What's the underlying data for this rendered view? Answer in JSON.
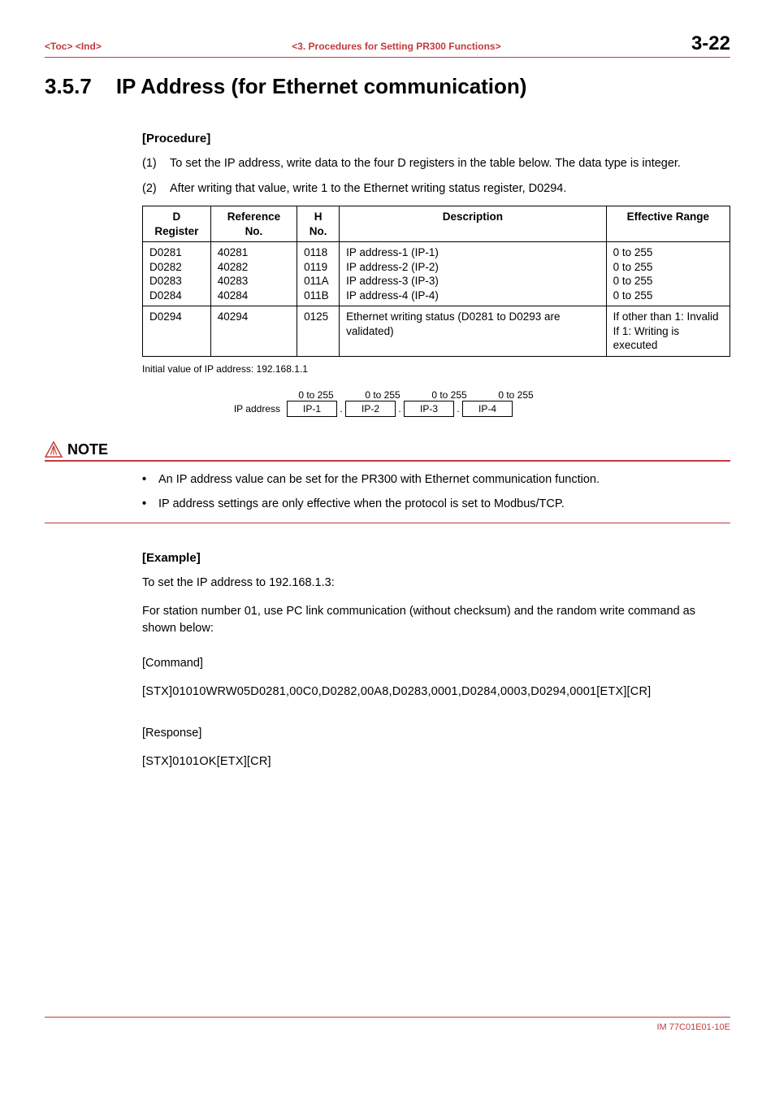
{
  "header": {
    "toc": "<Toc>",
    "ind": "<Ind>",
    "center": "<3.  Procedures for Setting PR300 Functions>",
    "pageNum": "3-22"
  },
  "section": {
    "num": "3.5.7",
    "title": "IP Address (for Ethernet communication)"
  },
  "procedure": {
    "label": "[Procedure]",
    "items": [
      {
        "n": "(1)",
        "t": "To set the IP address, write data to the four D registers in the table below. The data type is integer."
      },
      {
        "n": "(2)",
        "t": "After writing that value, write 1 to the Ethernet writing status register, D0294."
      }
    ]
  },
  "table": {
    "headers": [
      "D Register",
      "Reference No.",
      "H No.",
      "Description",
      "Effective Range"
    ],
    "rows": [
      {
        "c": [
          "D0281",
          "40281",
          "0118",
          "IP address-1 (IP-1)",
          "0 to 255"
        ]
      },
      {
        "c": [
          "D0282",
          "40282",
          "0119",
          "IP address-2 (IP-2)",
          "0 to 255"
        ]
      },
      {
        "c": [
          "D0283",
          "40283",
          "011A",
          "IP address-3 (IP-3)",
          "0 to 255"
        ]
      },
      {
        "c": [
          "D0284",
          "40284",
          "011B",
          "IP address-4 (IP-4)",
          "0 to 255"
        ]
      }
    ],
    "lastrow": {
      "c": [
        "D0294",
        "40294",
        "0125",
        "Ethernet writing status (D0281 to D0293 are validated)",
        "If other than 1: Invalid\nIf 1: Writing is executed"
      ]
    }
  },
  "initial": "Initial value of IP address: 192.168.1.1",
  "ipdiag": {
    "range": "0 to 255",
    "label": "IP address",
    "boxes": [
      "IP-1",
      "IP-2",
      "IP-3",
      "IP-4"
    ]
  },
  "note": {
    "title": "NOTE",
    "bullets": [
      "An IP address value can be set for the PR300 with Ethernet communication function.",
      "IP address settings are only effective when the protocol is set to Modbus/TCP."
    ]
  },
  "example": {
    "label": "[Example]",
    "p1": "To set the IP address to 192.168.1.3:",
    "p2": "For station number 01, use PC link communication (without checksum) and the random write command as shown below:",
    "cmdLabel": "[Command]",
    "cmd": "[STX]01010WRW05D0281,00C0,D0282,00A8,D0283,0001,D0284,0003,D0294,0001[ETX][CR]",
    "respLabel": "[Response]",
    "resp": "[STX]0101OK[ETX][CR]"
  },
  "footer": {
    "doc": "IM 77C01E01-10E"
  }
}
